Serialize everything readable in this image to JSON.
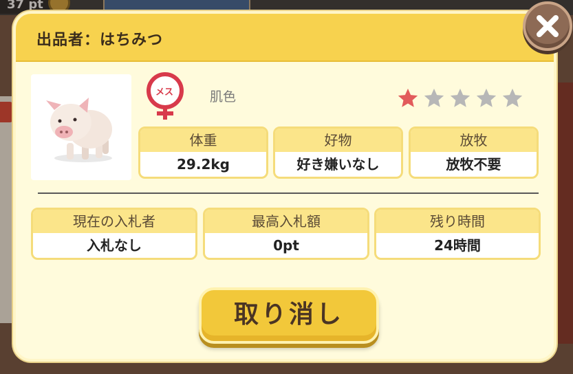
{
  "background": {
    "points_text": "37 pt"
  },
  "dialog": {
    "title": "出品者：はちみつ",
    "gender_label": "メス",
    "color_label": "肌色",
    "rating": {
      "value": 1,
      "max": 5,
      "active_color": "#e25b5b",
      "inactive_color": "#b7b7b7"
    },
    "stats": [
      {
        "label": "体重",
        "value": "29.2kg"
      },
      {
        "label": "好物",
        "value": "好き嫌いなし"
      },
      {
        "label": "放牧",
        "value": "放牧不要"
      }
    ],
    "auction": [
      {
        "label": "現在の入札者",
        "value": "入札なし"
      },
      {
        "label": "最高入札額",
        "value": "0pt"
      },
      {
        "label": "残り時間",
        "value": "24時間"
      }
    ],
    "cancel_label": "取り消し"
  },
  "colors": {
    "header": "#f7d24e",
    "panel": "#fffbdc",
    "accent_red": "#d83a4b",
    "button": "#f2c83a"
  },
  "icons": [
    "close-icon",
    "female-gender-icon",
    "star-icon",
    "pig-image"
  ]
}
